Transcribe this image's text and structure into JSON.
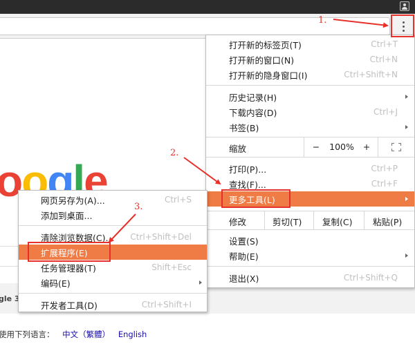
{
  "main_menu": {
    "new_tab": {
      "label": "打开新的标签页(T)",
      "shortcut": "Ctrl+T"
    },
    "new_window": {
      "label": "打开新的窗口(N)",
      "shortcut": "Ctrl+N"
    },
    "new_incognito": {
      "label": "打开新的隐身窗口(I)",
      "shortcut": "Ctrl+Shift+N"
    },
    "history": {
      "label": "历史记录(H)"
    },
    "downloads": {
      "label": "下载内容(D)",
      "shortcut": "Ctrl+J"
    },
    "bookmarks": {
      "label": "书签(B)"
    },
    "zoom": {
      "label": "缩放",
      "minus": "−",
      "value": "100%",
      "plus": "+"
    },
    "print": {
      "label": "打印(P)...",
      "shortcut": "Ctrl+P"
    },
    "find": {
      "label": "查找(F)...",
      "shortcut": "Ctrl+F"
    },
    "more_tools": {
      "label": "更多工具(L)"
    },
    "edit": {
      "label": "修改",
      "cut": "剪切(T)",
      "copy": "复制(C)",
      "paste": "粘贴(P)"
    },
    "settings": {
      "label": "设置(S)"
    },
    "help": {
      "label": "帮助(E)"
    },
    "exit": {
      "label": "退出(X)",
      "shortcut": "Ctrl+Shift+Q"
    }
  },
  "sub_menu": {
    "save_page": {
      "label": "网页另存为(A)...",
      "shortcut": "Ctrl+S"
    },
    "add_to_desktop": {
      "label": "添加到桌面..."
    },
    "clear_data": {
      "label": "清除浏览数据(C)...",
      "shortcut": "Ctrl+Shift+Del"
    },
    "extensions": {
      "label": "扩展程序(E)"
    },
    "task_manager": {
      "label": "任务管理器(T)",
      "shortcut": "Shift+Esc"
    },
    "encoding": {
      "label": "编码(E)"
    },
    "dev_tools": {
      "label": "开发者工具(D)",
      "shortcut": "Ctrl+Shift+I"
    }
  },
  "page": {
    "logo_letters": [
      "o",
      "o",
      "g",
      "l",
      "e"
    ],
    "google_fragment": "gle 3",
    "language_prompt": "使用下列语言：",
    "language_links": [
      "中文（繁體）",
      "English"
    ]
  },
  "annotations": {
    "step1": "1.",
    "step2": "2.",
    "step3": "3."
  },
  "colors": {
    "highlight": "#ef7b45",
    "annotation_red": "#e8302a"
  }
}
